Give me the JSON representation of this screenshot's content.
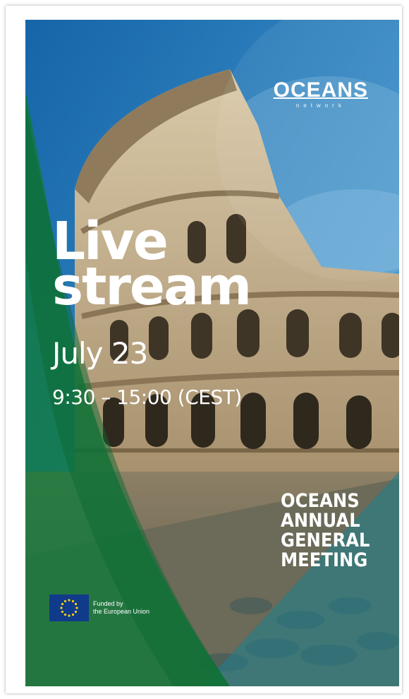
{
  "logo": {
    "name": "OCEANS",
    "tagline": "network"
  },
  "headline": {
    "line1": "Live",
    "line2": "stream"
  },
  "event": {
    "date": "July 23",
    "time": "9:30 – 15:00 (CEST)"
  },
  "meeting": {
    "line1": "OCEANS",
    "line2": "ANNUAL",
    "line3": "GENERAL",
    "line4": "MEETING"
  },
  "funding": {
    "line1": "Funded by",
    "line2": "the European Union"
  },
  "colors": {
    "sky": "#1d6fae",
    "green": "#1f7a3c",
    "teal": "#2f8f9d",
    "stone": "#c9b79a"
  }
}
